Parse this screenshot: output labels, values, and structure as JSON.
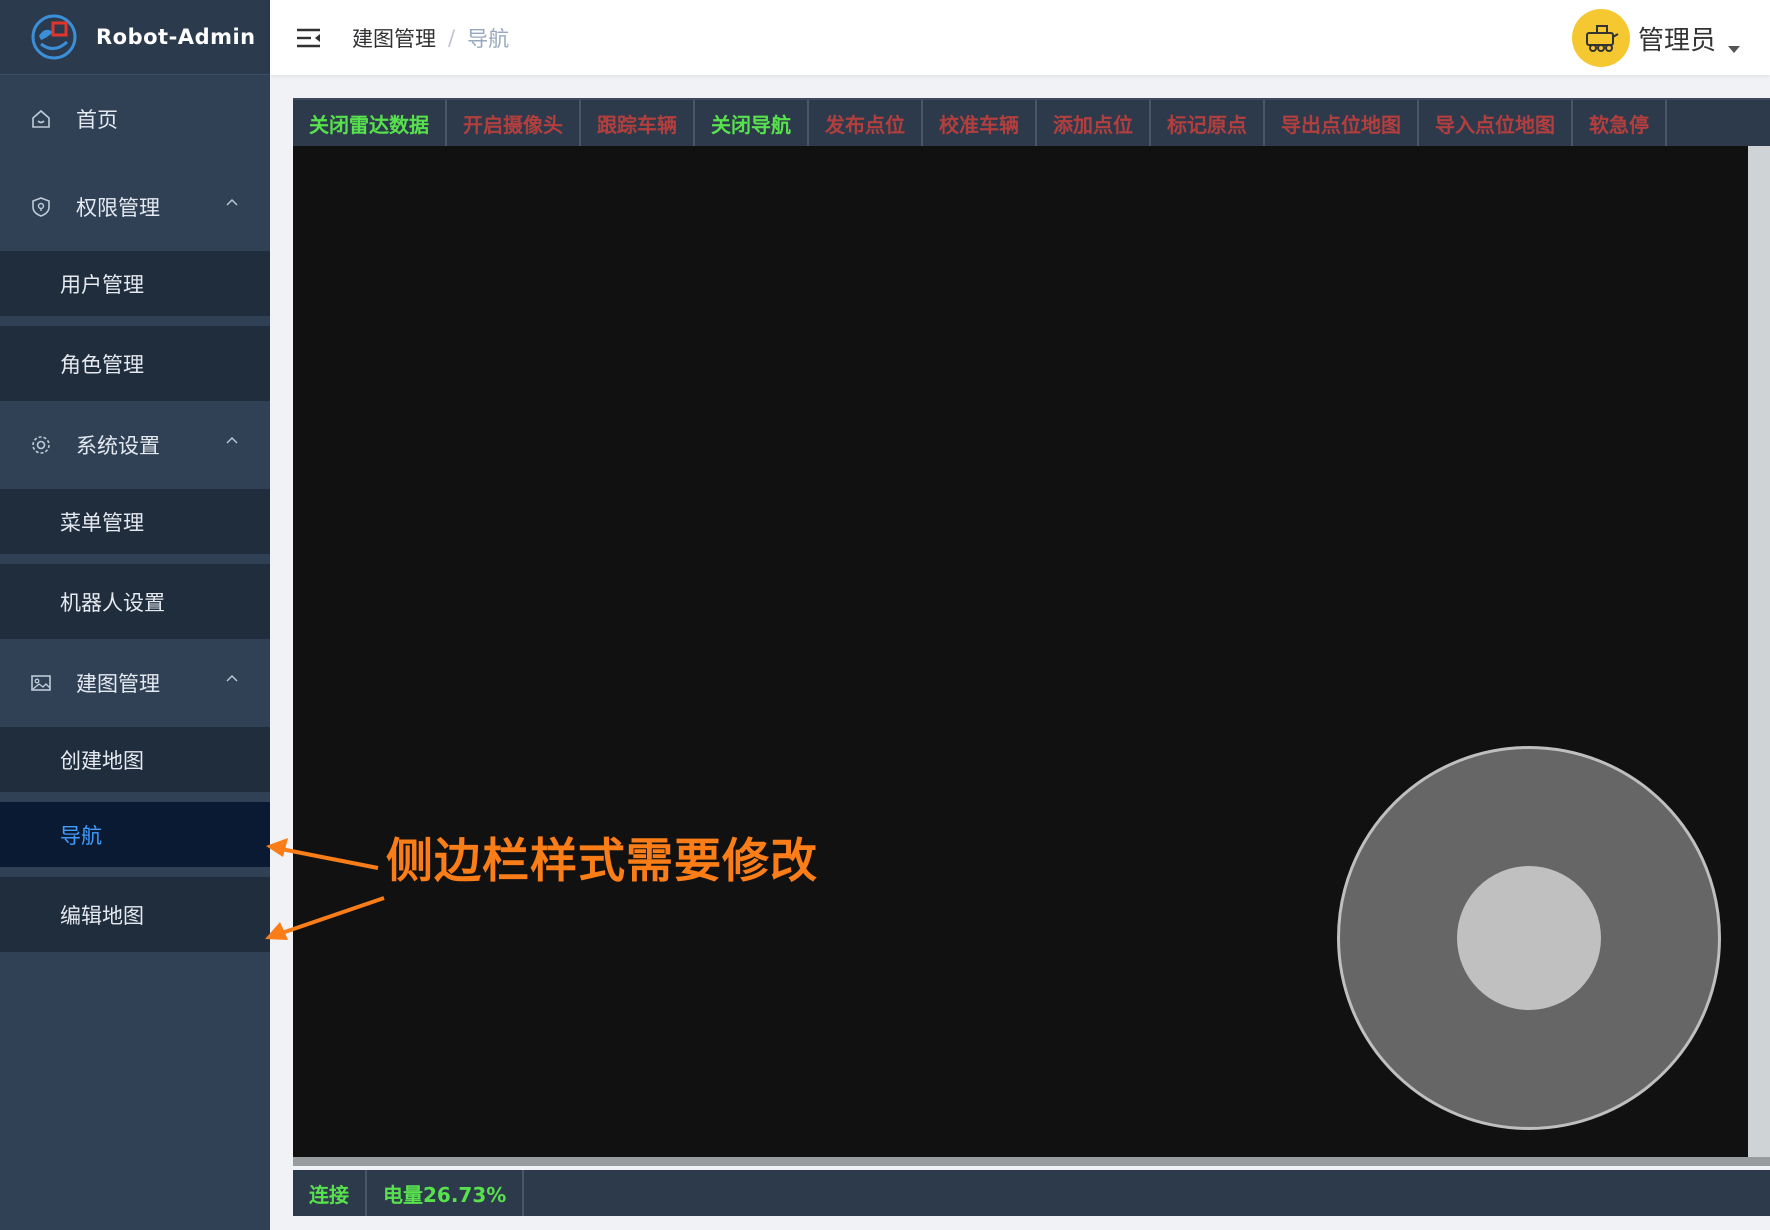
{
  "app": {
    "title": "Robot-Admin"
  },
  "sidebar": {
    "items": [
      {
        "label": "首页",
        "icon": "home-icon"
      },
      {
        "label": "权限管理",
        "icon": "shield-icon",
        "children": [
          "用户管理",
          "角色管理"
        ]
      },
      {
        "label": "系统设置",
        "icon": "gear-icon",
        "children": [
          "菜单管理",
          "机器人设置"
        ]
      },
      {
        "label": "建图管理",
        "icon": "image-icon",
        "children": [
          "创建地图",
          "导航",
          "编辑地图"
        ]
      }
    ],
    "active": "导航"
  },
  "header": {
    "breadcrumb": [
      "建图管理",
      "导航"
    ],
    "separator": "/",
    "user": "管理员"
  },
  "toolbar": {
    "buttons": [
      {
        "label": "关闭雷达数据",
        "state": "on"
      },
      {
        "label": "开启摄像头",
        "state": "off"
      },
      {
        "label": "跟踪车辆",
        "state": "off"
      },
      {
        "label": "关闭导航",
        "state": "on"
      },
      {
        "label": "发布点位",
        "state": "off"
      },
      {
        "label": "校准车辆",
        "state": "off"
      },
      {
        "label": "添加点位",
        "state": "off"
      },
      {
        "label": "标记原点",
        "state": "off"
      },
      {
        "label": "导出点位地图",
        "state": "off"
      },
      {
        "label": "导入点位地图",
        "state": "off"
      },
      {
        "label": "软急停",
        "state": "off"
      }
    ]
  },
  "status": {
    "connection": "连接",
    "battery": "电量26.73%"
  },
  "annotation": {
    "text": "侧边栏样式需要修改"
  },
  "colors": {
    "sidebar_bg": "#304156",
    "submenu_bg": "#1f2d3d",
    "active_text": "#409eff",
    "toolbar_on": "#57e14c",
    "toolbar_off": "#b33e3e",
    "annotation": "#fa7d17"
  }
}
